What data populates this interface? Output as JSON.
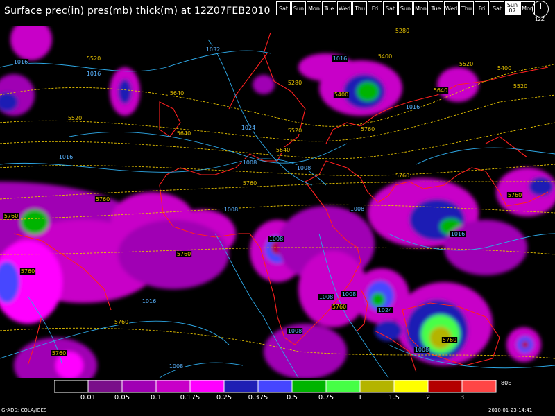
{
  "title": "Surface prec(in) pres(mb) thick(m) at 12Z07FEB2010",
  "days": [
    "Sat",
    "Sun",
    "Mon",
    "Tue",
    "Wed",
    "Thu",
    "Fri",
    "Sat",
    "Sun",
    "Mon",
    "Tue",
    "Wed",
    "Thu",
    "Fri",
    "Sat"
  ],
  "active_day": {
    "name": "Sun",
    "date": "07"
  },
  "last_day": "Mon",
  "clock_label": "12Z",
  "contour_labels": {
    "pressure": [
      "1016",
      "1032",
      "1016",
      "1024",
      "1016",
      "1008",
      "1016",
      "1008",
      "1008",
      "1008",
      "1008",
      "1016",
      "1008",
      "1008",
      "1016",
      "1008",
      "1016",
      "1024",
      "1008",
      "1008"
    ],
    "thickness": [
      "5520",
      "5640",
      "5520",
      "5640",
      "5640",
      "5520",
      "5400",
      "5280",
      "5280",
      "5400",
      "5520",
      "5400",
      "5520",
      "5640",
      "5760",
      "5760",
      "5760",
      "5760",
      "5760",
      "5760",
      "5760",
      "5760",
      "5760",
      "5760",
      "5760",
      "5760"
    ]
  },
  "colorbar": {
    "colors": [
      "#000000",
      "#7a0f8a",
      "#a000b4",
      "#c800c8",
      "#ff00ff",
      "#1e1eb4",
      "#4646ff",
      "#00b400",
      "#46ff46",
      "#b4b400",
      "#ffff00",
      "#b40000",
      "#ff4646"
    ],
    "ticks": [
      "0.01",
      "0.05",
      "0.1",
      "0.175",
      "0.25",
      "0.375",
      "0.5",
      "0.75",
      "1",
      "1.5",
      "2",
      "3"
    ]
  },
  "lon_label": "80E",
  "credit": "GrADS: COLA/IGES",
  "timestamp": "2010-01-23-14:41"
}
